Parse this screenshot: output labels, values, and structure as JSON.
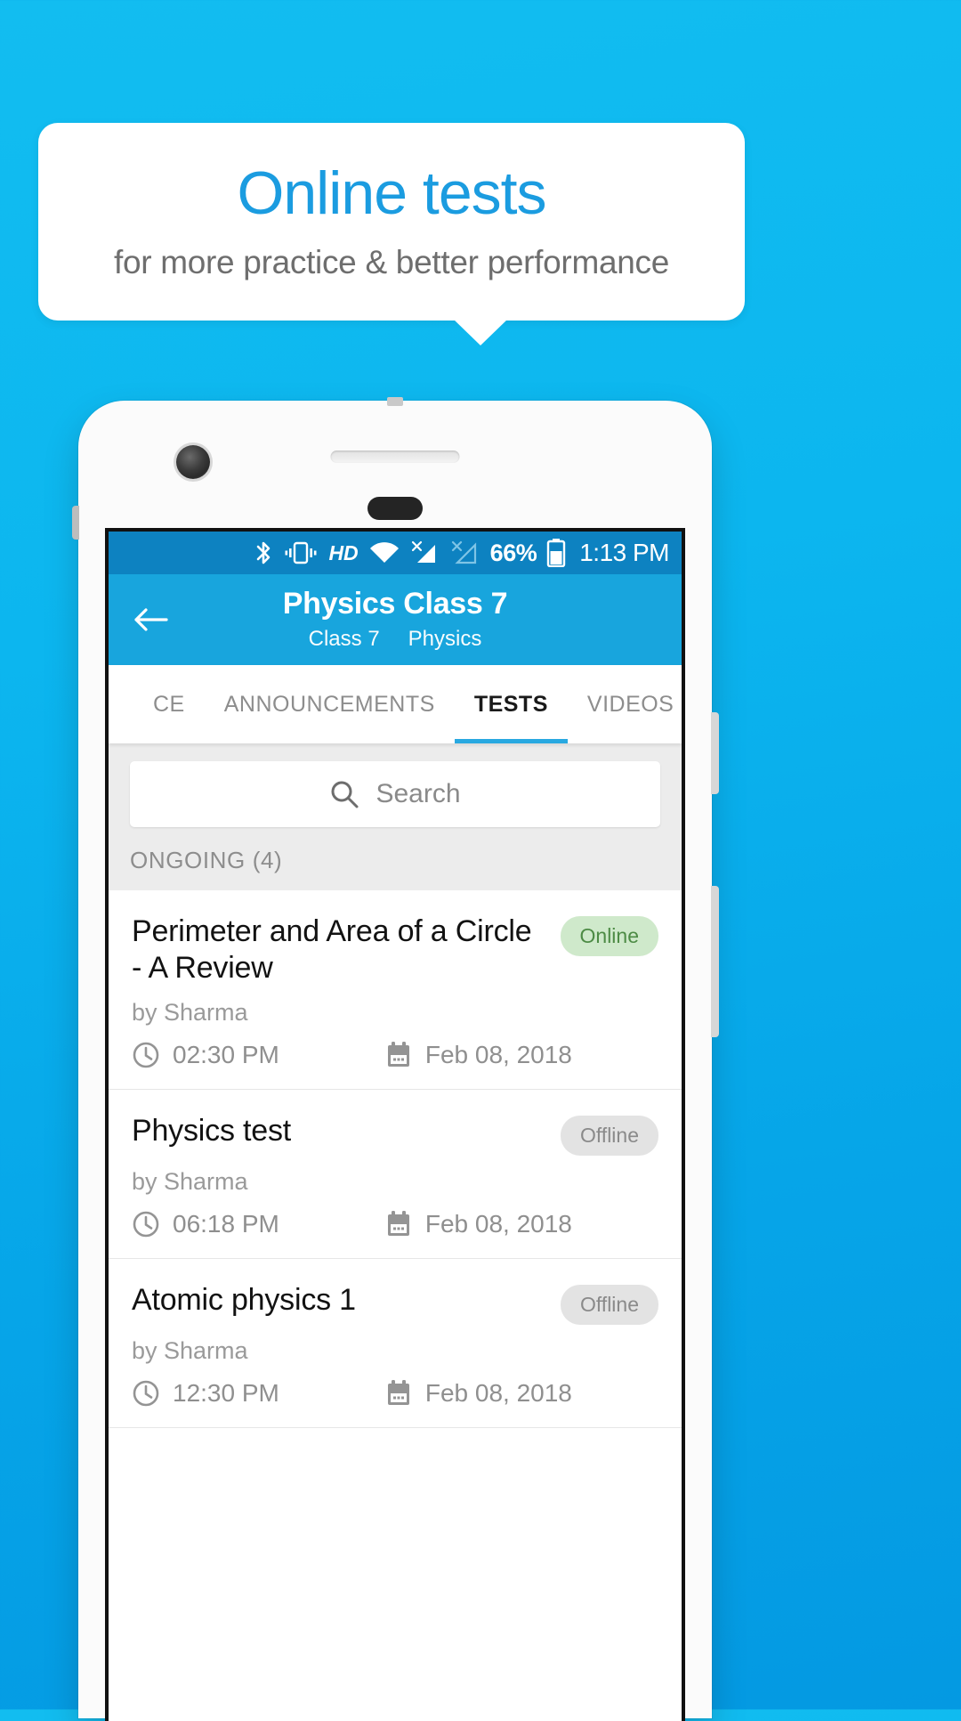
{
  "promo": {
    "title": "Online tests",
    "subtitle": "for more practice & better performance",
    "title_color": "#1b9ce0",
    "subtitle_color": "#6e6e6e",
    "background_color": "#0cb6ef"
  },
  "status_bar": {
    "icons": [
      "bluetooth-icon",
      "vibrate-icon",
      "hd-icon",
      "wifi-icon",
      "signal-no-sim-icon",
      "signal-no-sim-2-icon",
      "battery-icon"
    ],
    "hd_label": "HD",
    "battery_percent": "66%",
    "time": "1:13 PM",
    "background_color": "#0d82c1"
  },
  "app_bar": {
    "back_icon": "arrow-left-icon",
    "title": "Physics Class 7",
    "subtitle_class": "Class 7",
    "subtitle_subject": "Physics",
    "background_color": "#18a5dd"
  },
  "tabs": {
    "items": [
      {
        "label": "CE",
        "active": false
      },
      {
        "label": "ANNOUNCEMENTS",
        "active": false
      },
      {
        "label": "TESTS",
        "active": true
      },
      {
        "label": "VIDEOS",
        "active": false
      }
    ],
    "indicator_color": "#29a9e1"
  },
  "search": {
    "icon": "search-icon",
    "placeholder": "Search",
    "value": ""
  },
  "section": {
    "label": "ONGOING (4)"
  },
  "tests": [
    {
      "title": "Perimeter and Area of a Circle - A Review",
      "status": "Online",
      "status_type": "online",
      "author": "by Sharma",
      "time": "02:30 PM",
      "date": "Feb 08, 2018",
      "clock_icon": "clock-icon",
      "calendar_icon": "calendar-icon"
    },
    {
      "title": "Physics test",
      "status": "Offline",
      "status_type": "offline",
      "author": "by Sharma",
      "time": "06:18 PM",
      "date": "Feb 08, 2018",
      "clock_icon": "clock-icon",
      "calendar_icon": "calendar-icon"
    },
    {
      "title": "Atomic physics 1",
      "status": "Offline",
      "status_type": "offline",
      "author": "by Sharma",
      "time": "12:30 PM",
      "date": "Feb 08, 2018",
      "clock_icon": "clock-icon",
      "calendar_icon": "calendar-icon"
    }
  ]
}
